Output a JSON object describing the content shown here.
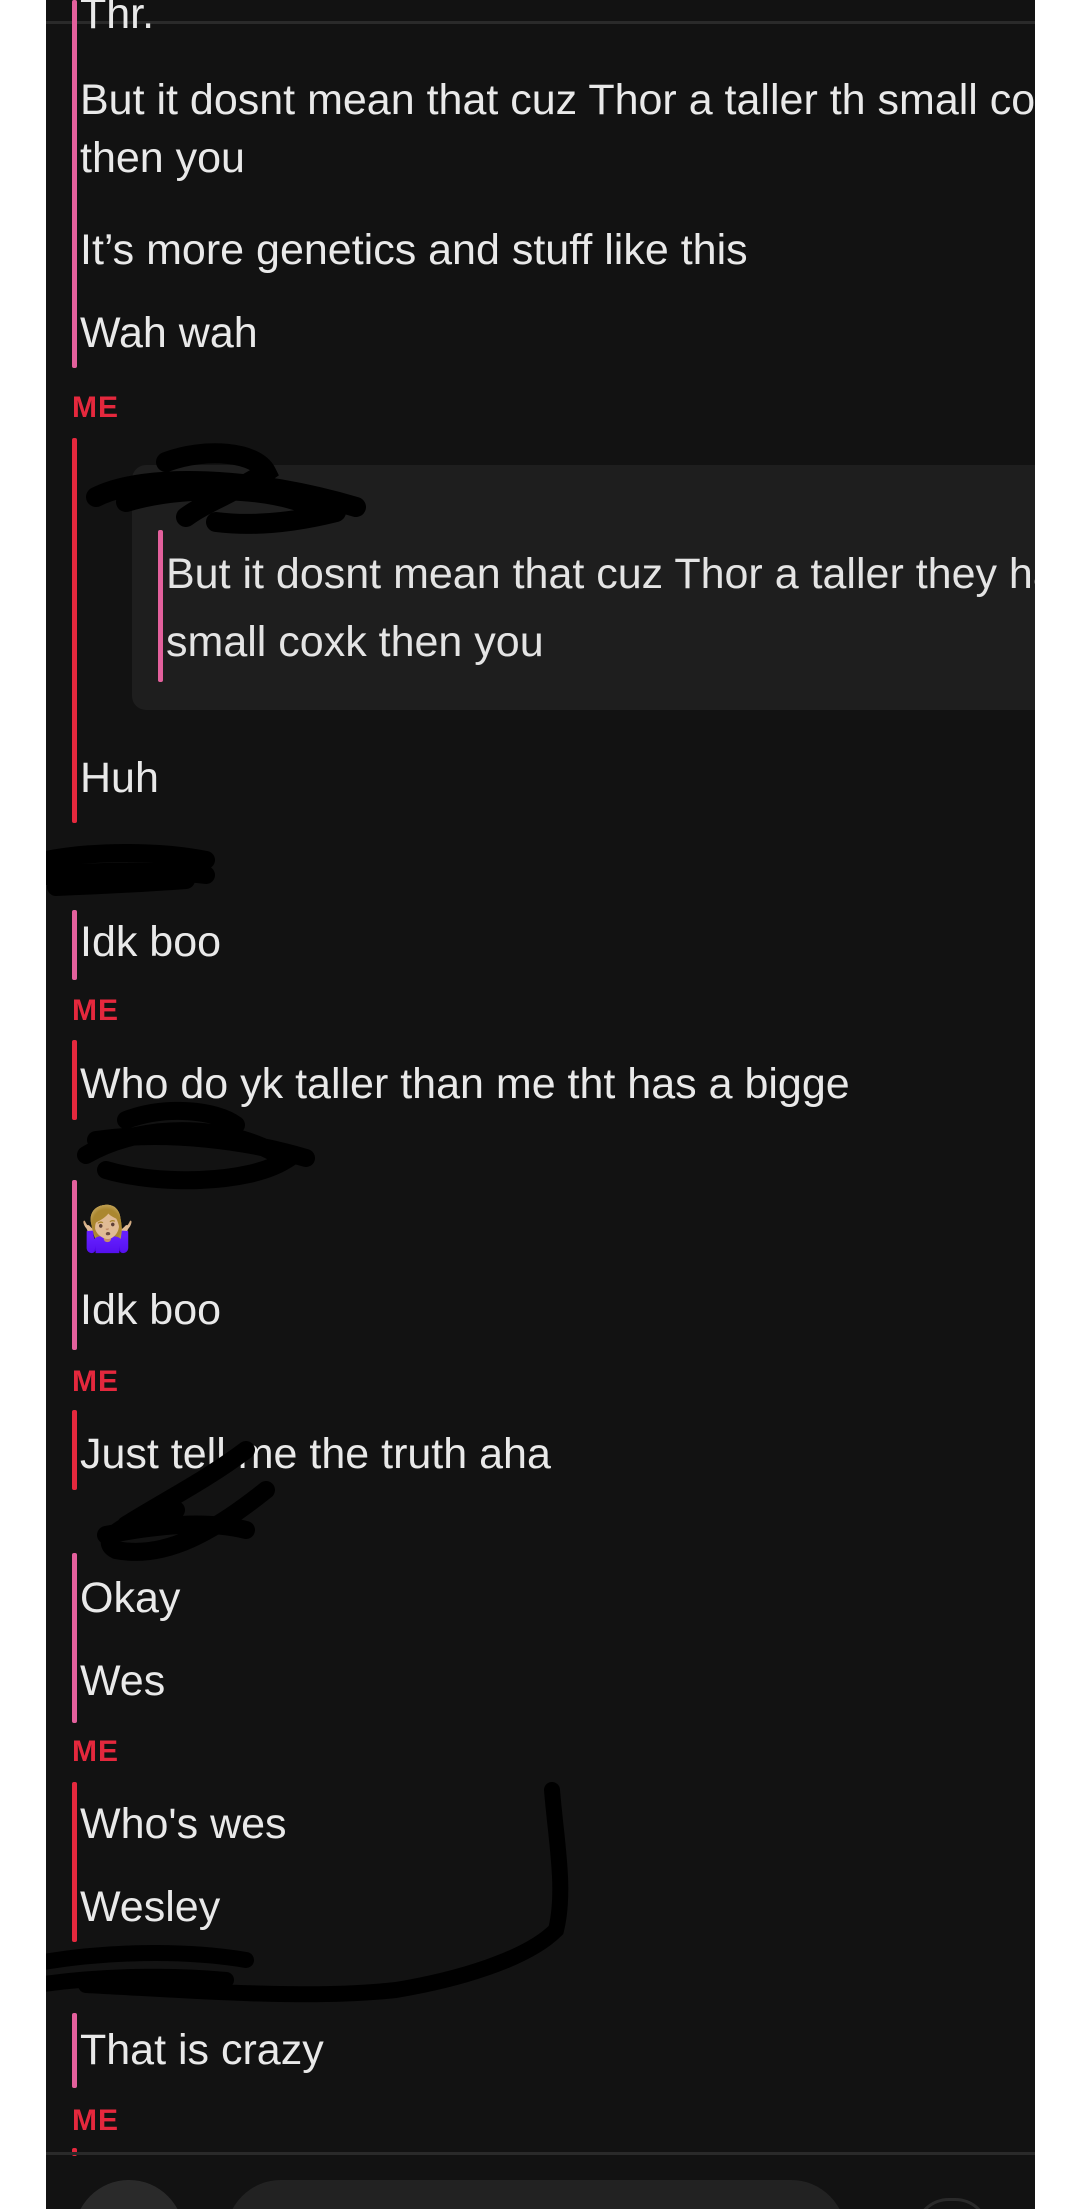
{
  "conversation": {
    "top_partial": "Thr.",
    "partner_group_1": [
      "But it dosnt mean that cuz Thor a taller th small coxk then you",
      "It’s more genetics and stuff like this",
      "Wah wah"
    ],
    "me_label": "ME",
    "reply_quote_text": "But it dosnt mean that cuz Thor a taller they have small coxk then you",
    "me_msg_1": "Huh",
    "partner_msg_2": "Idk boo",
    "me_msg_2": "Who do yk taller than me tht has a bigge",
    "partner_emoji": "🤷🏼‍♀️",
    "partner_msg_3": "Idk boo",
    "me_msg_3": "Just tell me the truth aha",
    "partner_group_4": [
      "Okay",
      "Wes"
    ],
    "me_group_4": [
      "Who's wes",
      "Wesley"
    ],
    "partner_msg_5": "That is crazy"
  },
  "colors": {
    "background": "#121212",
    "partner_accent": "#e3609c",
    "me_accent": "#e5283d",
    "text": "#e9e9e9"
  }
}
